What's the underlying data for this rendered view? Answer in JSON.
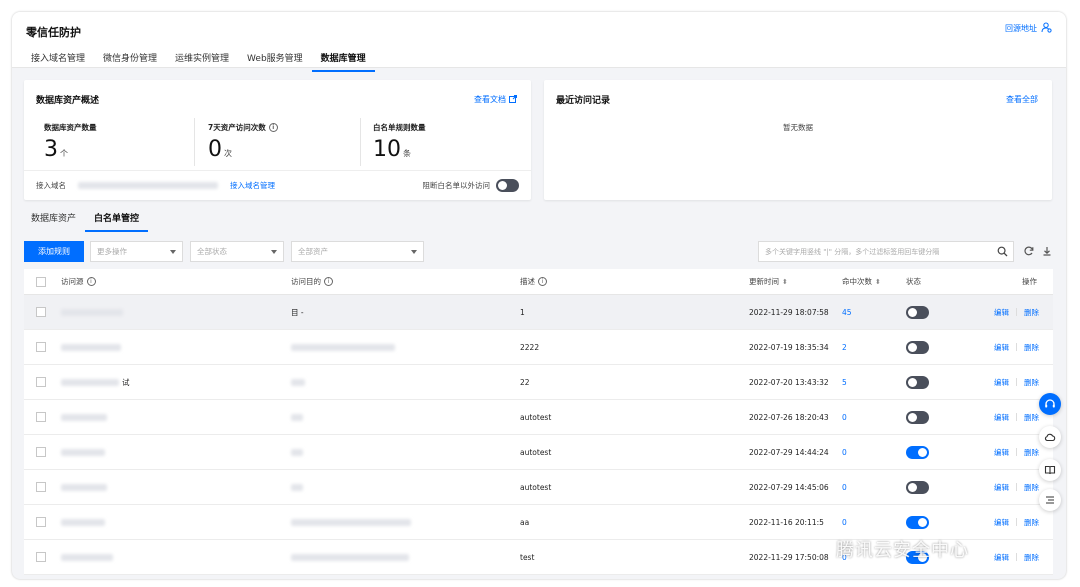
{
  "app": {
    "title": "零信任防护",
    "origin_link": "回源地址"
  },
  "tabs": [
    {
      "label": "接入域名管理",
      "active": false
    },
    {
      "label": "微信身份管理",
      "active": false
    },
    {
      "label": "运维实例管理",
      "active": false
    },
    {
      "label": "Web服务管理",
      "active": false
    },
    {
      "label": "数据库管理",
      "active": true
    }
  ],
  "overview": {
    "title": "数据库资产概述",
    "doc_link": "查看文档",
    "stats": [
      {
        "label": "数据库资产数量",
        "value": "3",
        "unit": "个"
      },
      {
        "label": "7天资产访问次数",
        "value": "0",
        "unit": "次"
      },
      {
        "label": "白名单规则数量",
        "value": "10",
        "unit": "条"
      }
    ],
    "domain_label": "接入域名",
    "domain_manage_link": "接入域名管理",
    "block_label": "阻断白名单以外访问",
    "block_enabled": false
  },
  "recent": {
    "title": "最近访问记录",
    "view_all": "查看全部",
    "empty": "暂无数据"
  },
  "subtabs": [
    {
      "label": "数据库资产",
      "active": false
    },
    {
      "label": "白名单管控",
      "active": true
    }
  ],
  "toolbar": {
    "add_rule": "添加规则",
    "more_ops": "更多操作",
    "all_status": "全部状态",
    "all_assets": "全部资产",
    "search_placeholder": "多个关键字用竖线 \"|\" 分隔，多个过滤标签用回车键分隔"
  },
  "table": {
    "headers": {
      "source": "访问源",
      "target": "访问目的",
      "desc": "描述",
      "updated": "更新时间",
      "hits": "命中次数",
      "status": "状态",
      "action": "操作"
    },
    "rows": [
      {
        "target": "目 -",
        "desc": "1",
        "updated": "2022-11-29 18:07:58",
        "hits": "45",
        "status_on": false,
        "source_suffix": ""
      },
      {
        "target": "",
        "desc": "2222",
        "updated": "2022-07-19 18:35:34",
        "hits": "2",
        "status_on": false,
        "source_suffix": ""
      },
      {
        "target": "",
        "desc": "22",
        "updated": "2022-07-20 13:43:32",
        "hits": "5",
        "status_on": false,
        "source_suffix": "试"
      },
      {
        "target": "",
        "desc": "autotest",
        "updated": "2022-07-26 18:20:43",
        "hits": "0",
        "status_on": false,
        "source_suffix": ""
      },
      {
        "target": "",
        "desc": "autotest",
        "updated": "2022-07-29 14:44:24",
        "hits": "0",
        "status_on": true,
        "source_suffix": ""
      },
      {
        "target": "",
        "desc": "autotest",
        "updated": "2022-07-29 14:45:06",
        "hits": "0",
        "status_on": false,
        "source_suffix": ""
      },
      {
        "target": "",
        "desc": "aa",
        "updated": "2022-11-16 20:11:5",
        "hits": "0",
        "status_on": true,
        "source_suffix": ""
      },
      {
        "target": "",
        "desc": "test",
        "updated": "2022-11-29 17:50:08",
        "hits": "0",
        "status_on": true,
        "source_suffix": ""
      }
    ],
    "edit": "编辑",
    "delete": "删除"
  },
  "watermark": "腾讯云安全中心",
  "colors": {
    "primary": "#006eff",
    "toggle_off": "#4a4f5b"
  }
}
